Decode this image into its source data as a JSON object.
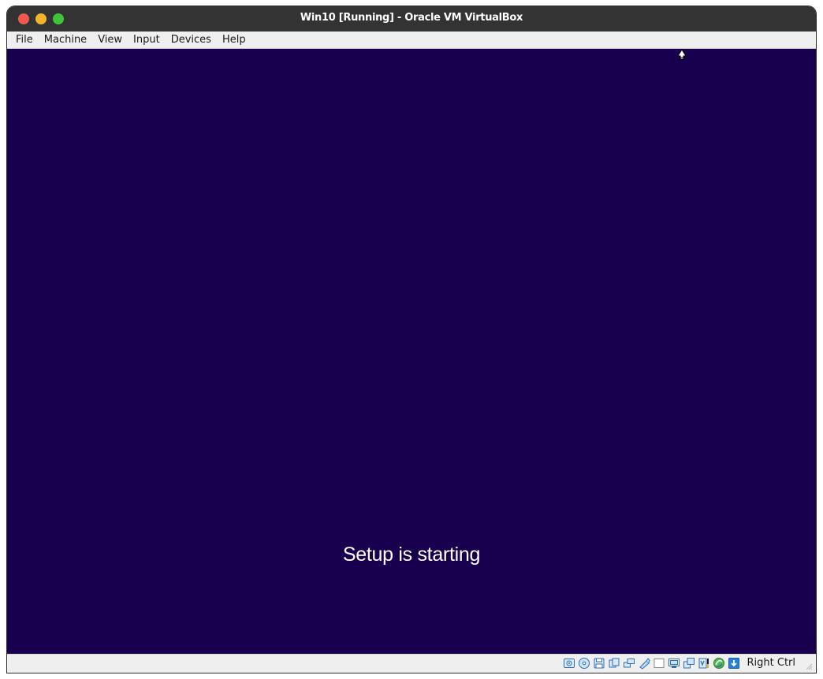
{
  "window": {
    "title": "Win10 [Running] - Oracle VM VirtualBox"
  },
  "menu": {
    "items": [
      "File",
      "Machine",
      "View",
      "Input",
      "Devices",
      "Help"
    ]
  },
  "vm": {
    "message": "Setup is starting",
    "background_color": "#19004f"
  },
  "statusbar": {
    "icons": [
      "hard-disk-icon",
      "optical-drive-icon",
      "floppy-drive-icon",
      "audio-icon",
      "network-icon",
      "usb-icon",
      "shared-folders-icon",
      "display-icon",
      "video-capture-icon",
      "cpu-icon",
      "mouse-integration-icon",
      "keyboard-capture-icon"
    ],
    "host_key": "Right Ctrl"
  },
  "colors": {
    "close": "#ee5a52",
    "minimize": "#f4b52b",
    "maximize": "#40c53a",
    "titlebar": "#333333"
  }
}
